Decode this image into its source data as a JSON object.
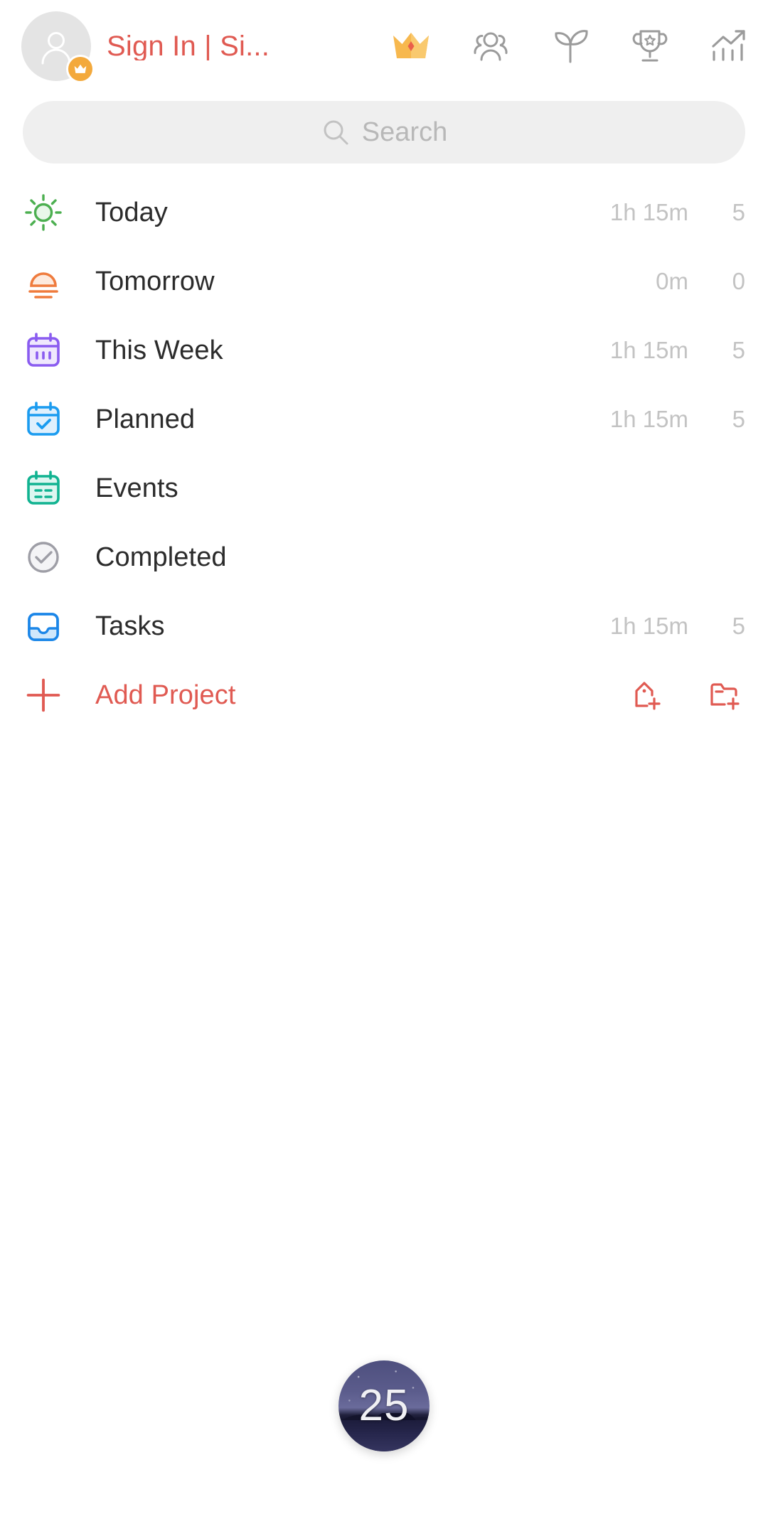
{
  "header": {
    "avatar_icon": "person-avatar-icon",
    "crown_badge_icon": "crown-badge-icon",
    "signin_label": "Sign In | Si...",
    "accent_color": "#e05a52",
    "icons": [
      {
        "name": "crown-icon",
        "label": "Premium"
      },
      {
        "name": "people-icon",
        "label": "Friends"
      },
      {
        "name": "sprout-icon",
        "label": "Focus"
      },
      {
        "name": "trophy-icon",
        "label": "Achievements"
      },
      {
        "name": "statistics-icon",
        "label": "Statistics"
      }
    ]
  },
  "search": {
    "icon": "search-icon",
    "placeholder": "Search",
    "value": ""
  },
  "list": {
    "items": [
      {
        "label": "Today",
        "icon": "sun-icon",
        "duration": "1h 15m",
        "count": "5"
      },
      {
        "label": "Tomorrow",
        "icon": "sunrise-icon",
        "duration": "0m",
        "count": "0"
      },
      {
        "label": "This Week",
        "icon": "calendar-week-icon",
        "duration": "1h 15m",
        "count": "5"
      },
      {
        "label": "Planned",
        "icon": "calendar-check-icon",
        "duration": "1h 15m",
        "count": "5"
      },
      {
        "label": "Events",
        "icon": "calendar-events-icon",
        "duration": "",
        "count": ""
      },
      {
        "label": "Completed",
        "icon": "check-circle-icon",
        "duration": "",
        "count": ""
      },
      {
        "label": "Tasks",
        "icon": "inbox-icon",
        "duration": "1h 15m",
        "count": "5"
      }
    ]
  },
  "add_project": {
    "label": "Add Project",
    "plus_icon": "plus-icon",
    "actions": [
      {
        "name": "add-tag-icon",
        "label": "Add Tag"
      },
      {
        "name": "add-folder-icon",
        "label": "Add Folder"
      }
    ]
  },
  "fab": {
    "number": "25",
    "icon": "pomodoro-timer-fab"
  },
  "colors": {
    "accent": "#e05a52",
    "today": "#4caf50",
    "tomorrow": "#ef7b3d",
    "this_week": "#8a5cf0",
    "planned": "#1b9cf0",
    "events": "#11b391",
    "completed": "#9e9ea6",
    "tasks": "#1b86e8",
    "muted_text": "#c3c3c3"
  }
}
